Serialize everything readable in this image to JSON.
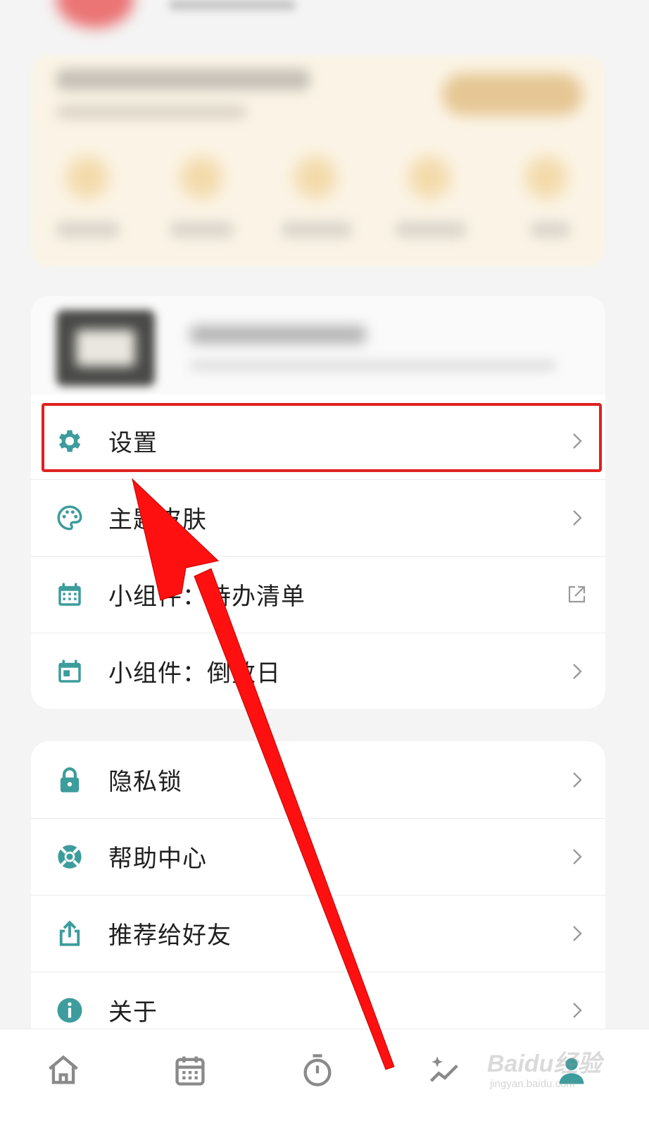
{
  "menu_group_1": [
    {
      "label": "设置",
      "icon": "gear-icon",
      "action": "chevron"
    },
    {
      "label": "主题皮肤",
      "icon": "palette-icon",
      "action": "chevron"
    },
    {
      "label": "小组件：待办清单",
      "icon": "calendar-grid-icon",
      "action": "external"
    },
    {
      "label": "小组件：倒数日",
      "icon": "calendar-day-icon",
      "action": "chevron"
    }
  ],
  "menu_group_2": [
    {
      "label": "隐私锁",
      "icon": "lock-icon",
      "action": "chevron"
    },
    {
      "label": "帮助中心",
      "icon": "lifebuoy-icon",
      "action": "chevron"
    },
    {
      "label": "推荐给好友",
      "icon": "share-icon",
      "action": "chevron"
    },
    {
      "label": "关于",
      "icon": "info-icon",
      "action": "chevron"
    }
  ],
  "bottom_nav": [
    {
      "name": "home-icon"
    },
    {
      "name": "calendar-icon"
    },
    {
      "name": "timer-icon"
    },
    {
      "name": "sparkle-chart-icon"
    },
    {
      "name": "profile-icon",
      "active": true
    }
  ],
  "watermark": {
    "brand": "Baidu经验",
    "url": "jingyan.baidu.com"
  },
  "colors": {
    "accent": "#3d9c9c",
    "highlight": "#e02020",
    "background": "#f4f4f4"
  }
}
